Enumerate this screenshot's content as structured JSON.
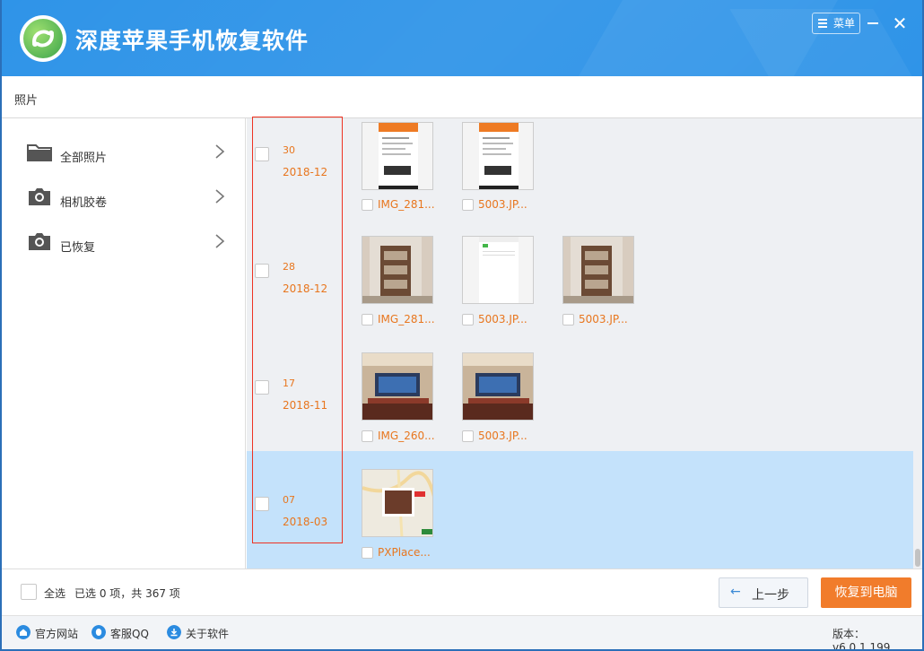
{
  "app": {
    "title": "深度苹果手机恢复软件",
    "menu_label": "菜单",
    "minimize_icon": "minimize-icon",
    "close_icon": "close-icon"
  },
  "breadcrumb": "照片",
  "sidebar": {
    "items": [
      {
        "label": "全部照片",
        "icon": "folder-icon"
      },
      {
        "label": "相机胶卷",
        "icon": "camera-icon"
      },
      {
        "label": "已恢复",
        "icon": "camera-icon"
      }
    ]
  },
  "groups": [
    {
      "day": "30",
      "month": "2018-12",
      "selected": false,
      "items": [
        {
          "name": "IMG_281...",
          "kind": "receipt"
        },
        {
          "name": "5003.JP...",
          "kind": "receipt"
        }
      ]
    },
    {
      "day": "28",
      "month": "2018-12",
      "selected": false,
      "items": [
        {
          "name": "IMG_281...",
          "kind": "room"
        },
        {
          "name": "5003.JP...",
          "kind": "screen"
        },
        {
          "name": "5003.JP...",
          "kind": "room"
        }
      ]
    },
    {
      "day": "17",
      "month": "2018-11",
      "selected": false,
      "items": [
        {
          "name": "IMG_260...",
          "kind": "tv"
        },
        {
          "name": "5003.JP...",
          "kind": "tv"
        }
      ]
    },
    {
      "day": "07",
      "month": "2018-03",
      "selected": true,
      "items": [
        {
          "name": "PXPlace...",
          "kind": "map"
        }
      ]
    }
  ],
  "action_bar": {
    "select_all_label": "全选",
    "selection_summary": "已选 0 项，共 367 项",
    "prev_label": "上一步",
    "recover_label": "恢复到电脑"
  },
  "footer": {
    "links": [
      {
        "label": "官方网站",
        "icon": "home-icon"
      },
      {
        "label": "客服QQ",
        "icon": "qq-icon"
      },
      {
        "label": "关于软件",
        "icon": "info-icon"
      }
    ],
    "version": "版本：v6.0.1.199"
  },
  "colors": {
    "titlebar": "#2f94e8",
    "accent_orange": "#f17c2b",
    "date_text": "#e8761e",
    "selected_row": "#c4e2fb"
  }
}
